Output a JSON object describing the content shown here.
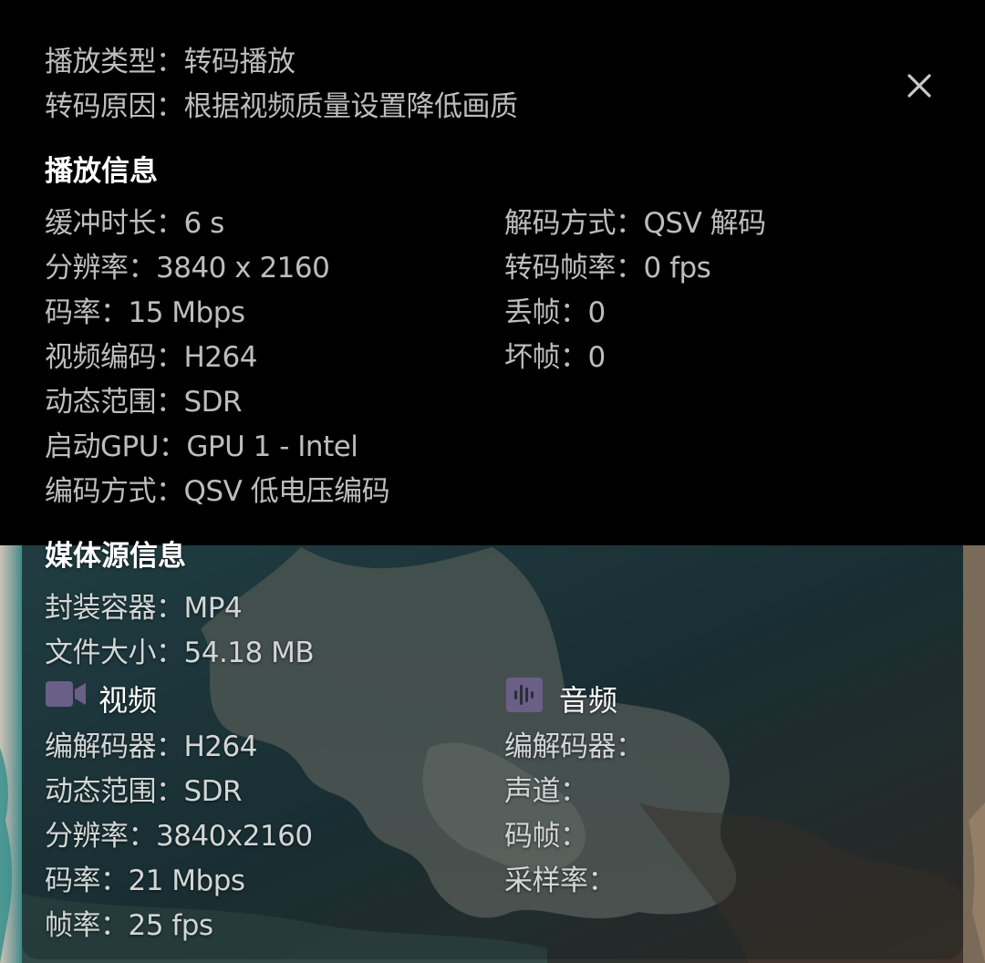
{
  "colors": {
    "text_primary": "#ffffff",
    "text_secondary": "#bdbdbd",
    "panel_bg": "#000000",
    "icon_tint": "#6a5f86"
  },
  "icons": {
    "close": "close-icon",
    "video": "video-camera-icon",
    "audio": "audio-waveform-icon"
  },
  "playback": {
    "type": {
      "label": "播放类型：",
      "value": "转码播放"
    },
    "reason": {
      "label": "转码原因：",
      "value": "根据视频质量设置降低画质"
    }
  },
  "playback_info": {
    "heading": "播放信息",
    "left": [
      {
        "label": "缓冲时长：",
        "value": "6 s"
      },
      {
        "label": "分辨率：",
        "value": "3840 x 2160"
      },
      {
        "label": "码率：",
        "value": "15 Mbps"
      },
      {
        "label": "视频编码：",
        "value": "H264"
      },
      {
        "label": "动态范围：",
        "value": "SDR"
      },
      {
        "label": "启动GPU：",
        "value": "GPU 1 - Intel"
      },
      {
        "label": "编码方式：",
        "value": "QSV 低电压编码"
      }
    ],
    "right": [
      {
        "label": "解码方式：",
        "value": "QSV 解码"
      },
      {
        "label": "转码帧率：",
        "value": "0 fps"
      },
      {
        "label": "丢帧：",
        "value": "0"
      },
      {
        "label": "坏帧：",
        "value": "0"
      }
    ]
  },
  "media_source": {
    "heading": "媒体源信息",
    "container": {
      "label": "封装容器：",
      "value": "MP4"
    },
    "file_size": {
      "label": "文件大小：",
      "value": "54.18 MB"
    },
    "video": {
      "title": "视频",
      "rows": [
        {
          "label": "编解码器：",
          "value": "H264"
        },
        {
          "label": "动态范围：",
          "value": "SDR"
        },
        {
          "label": "分辨率：",
          "value": "3840x2160"
        },
        {
          "label": "码率：",
          "value": "21 Mbps"
        },
        {
          "label": "帧率：",
          "value": "25 fps"
        }
      ]
    },
    "audio": {
      "title": "音频",
      "rows": [
        {
          "label": "编解码器：",
          "value": ""
        },
        {
          "label": "声道：",
          "value": ""
        },
        {
          "label": "码帧：",
          "value": ""
        },
        {
          "label": "采样率：",
          "value": ""
        }
      ]
    }
  }
}
